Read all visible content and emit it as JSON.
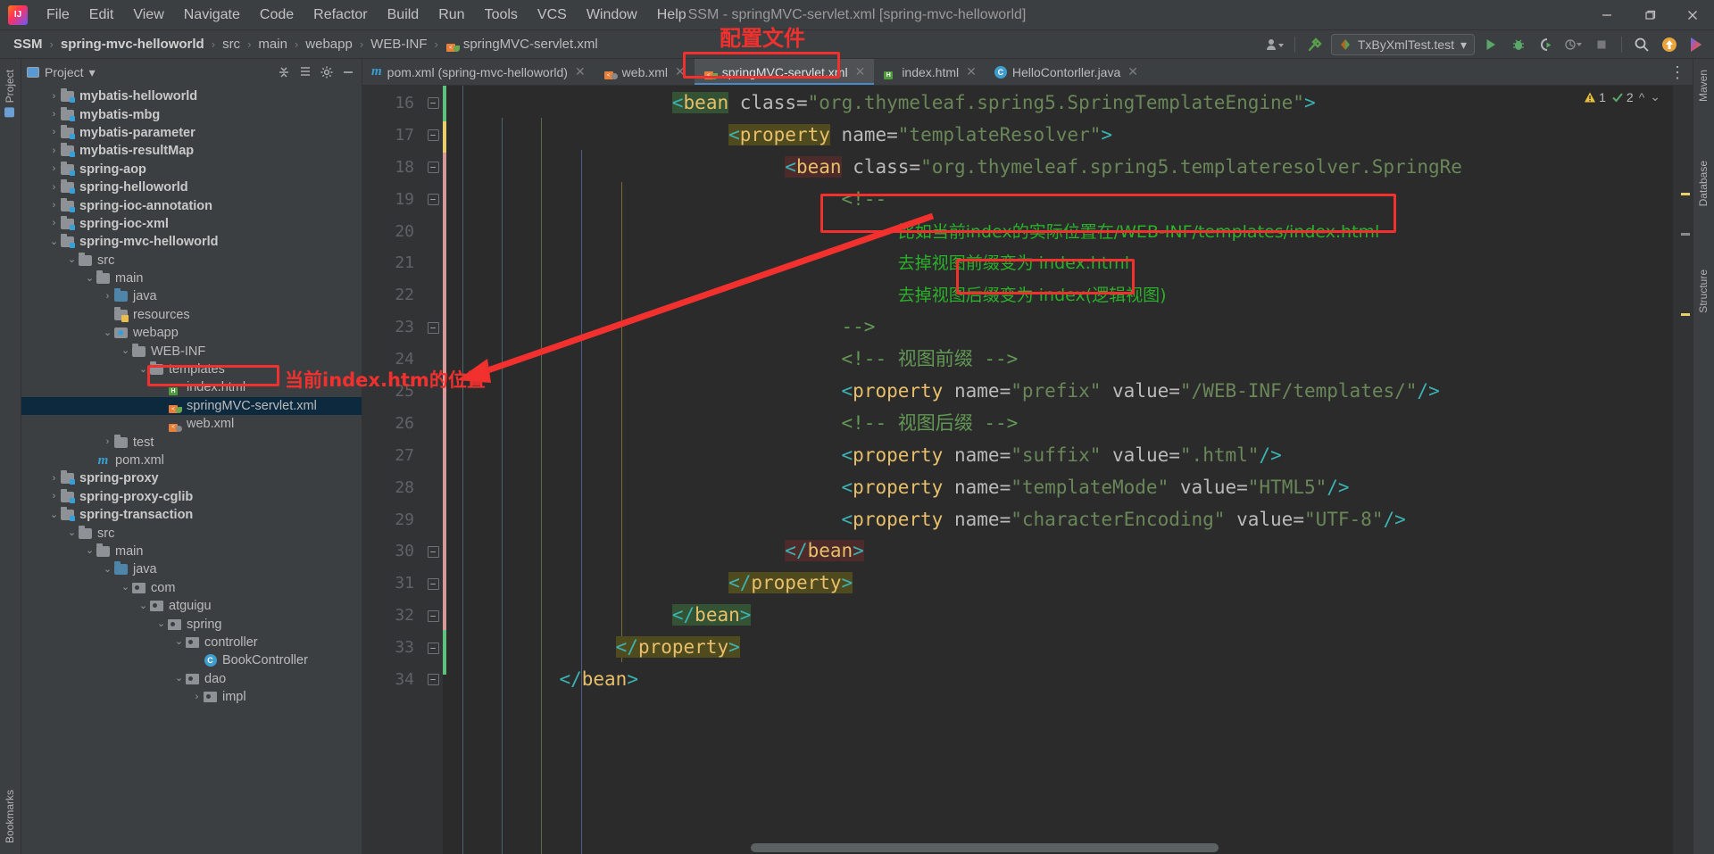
{
  "window": {
    "title": "SSM - springMVC-servlet.xml [spring-mvc-helloworld]",
    "minimize": "—",
    "maximize": "❐",
    "close": "✕"
  },
  "menu": {
    "items": [
      "File",
      "Edit",
      "View",
      "Navigate",
      "Code",
      "Refactor",
      "Build",
      "Run",
      "Tools",
      "VCS",
      "Window",
      "Help"
    ]
  },
  "breadcrumb": {
    "items": [
      "SSM",
      "spring-mvc-helloworld",
      "src",
      "main",
      "webapp",
      "WEB-INF",
      "springMVC-servlet.xml"
    ],
    "separator": "›"
  },
  "toolbar": {
    "run_config": "TxByXmlTest.test",
    "dropdown_caret": "▾",
    "run_label": "run-icon",
    "debug_label": "debug-icon",
    "coverage_label": "run-with-coverage-icon",
    "profile_label": "profiler-icon",
    "stop_label": "stop-icon",
    "search_label": "search-everywhere-icon",
    "update_label": "update-project-icon",
    "settings_label": "ide-assistant-icon"
  },
  "project_panel": {
    "title": "Project",
    "title_caret": "▾",
    "actions": [
      "expand-all-icon",
      "collapse-all-icon",
      "settings-icon",
      "hide-icon"
    ],
    "tree": [
      {
        "depth": 1,
        "label": "mybatis-helloworld",
        "arrow": "›",
        "icon": "module",
        "bold": true
      },
      {
        "depth": 1,
        "label": "mybatis-mbg",
        "arrow": "›",
        "icon": "module",
        "bold": true
      },
      {
        "depth": 1,
        "label": "mybatis-parameter",
        "arrow": "›",
        "icon": "module",
        "bold": true
      },
      {
        "depth": 1,
        "label": "mybatis-resultMap",
        "arrow": "›",
        "icon": "module",
        "bold": true
      },
      {
        "depth": 1,
        "label": "spring-aop",
        "arrow": "›",
        "icon": "module",
        "bold": true
      },
      {
        "depth": 1,
        "label": "spring-helloworld",
        "arrow": "›",
        "icon": "module",
        "bold": true
      },
      {
        "depth": 1,
        "label": "spring-ioc-annotation",
        "arrow": "›",
        "icon": "module",
        "bold": true
      },
      {
        "depth": 1,
        "label": "spring-ioc-xml",
        "arrow": "›",
        "icon": "module",
        "bold": true
      },
      {
        "depth": 1,
        "label": "spring-mvc-helloworld",
        "arrow": "⌄",
        "icon": "module",
        "bold": true
      },
      {
        "depth": 2,
        "label": "src",
        "arrow": "⌄",
        "icon": "folder"
      },
      {
        "depth": 3,
        "label": "main",
        "arrow": "⌄",
        "icon": "folder"
      },
      {
        "depth": 4,
        "label": "java",
        "arrow": "›",
        "icon": "folder-blue"
      },
      {
        "depth": 4,
        "label": "resources",
        "arrow": "",
        "icon": "folder-resources"
      },
      {
        "depth": 4,
        "label": "webapp",
        "arrow": "⌄",
        "icon": "webapp"
      },
      {
        "depth": 5,
        "label": "WEB-INF",
        "arrow": "⌄",
        "icon": "folder"
      },
      {
        "depth": 6,
        "label": "templates",
        "arrow": "⌄",
        "icon": "folder"
      },
      {
        "depth": 7,
        "label": "index.html",
        "arrow": "",
        "icon": "html"
      },
      {
        "depth": 7,
        "label": "springMVC-servlet.xml",
        "arrow": "",
        "icon": "xml-spring",
        "selected": true
      },
      {
        "depth": 7,
        "label": "web.xml",
        "arrow": "",
        "icon": "xml-web"
      },
      {
        "depth": 4,
        "label": "test",
        "arrow": "›",
        "icon": "folder"
      },
      {
        "depth": 3,
        "label": "pom.xml",
        "arrow": "",
        "icon": "maven"
      },
      {
        "depth": 1,
        "label": "spring-proxy",
        "arrow": "›",
        "icon": "module",
        "bold": true
      },
      {
        "depth": 1,
        "label": "spring-proxy-cglib",
        "arrow": "›",
        "icon": "module",
        "bold": true
      },
      {
        "depth": 1,
        "label": "spring-transaction",
        "arrow": "⌄",
        "icon": "module",
        "bold": true
      },
      {
        "depth": 2,
        "label": "src",
        "arrow": "⌄",
        "icon": "folder"
      },
      {
        "depth": 3,
        "label": "main",
        "arrow": "⌄",
        "icon": "folder"
      },
      {
        "depth": 4,
        "label": "java",
        "arrow": "⌄",
        "icon": "folder-blue"
      },
      {
        "depth": 5,
        "label": "com",
        "arrow": "⌄",
        "icon": "package"
      },
      {
        "depth": 6,
        "label": "atguigu",
        "arrow": "⌄",
        "icon": "package"
      },
      {
        "depth": 7,
        "label": "spring",
        "arrow": "⌄",
        "icon": "package"
      },
      {
        "depth": 8,
        "label": "controller",
        "arrow": "⌄",
        "icon": "package"
      },
      {
        "depth": 9,
        "label": "BookController",
        "arrow": "",
        "icon": "class"
      },
      {
        "depth": 8,
        "label": "dao",
        "arrow": "⌄",
        "icon": "package"
      },
      {
        "depth": 9,
        "label": "impl",
        "arrow": "›",
        "icon": "package"
      }
    ]
  },
  "editor_tabs": [
    {
      "label": "pom.xml (spring-mvc-helloworld)",
      "icon": "maven",
      "active": false
    },
    {
      "label": "web.xml",
      "icon": "xml-web",
      "active": false
    },
    {
      "label": "springMVC-servlet.xml",
      "icon": "xml-spring",
      "active": true
    },
    {
      "label": "index.html",
      "icon": "html",
      "active": false
    },
    {
      "label": "HelloContorller.java",
      "icon": "class",
      "active": false
    }
  ],
  "editor": {
    "first_line": 16,
    "line_numbers": [
      16,
      17,
      18,
      19,
      20,
      21,
      22,
      23,
      24,
      25,
      26,
      27,
      28,
      29,
      30,
      31,
      32,
      33,
      34
    ],
    "warnings": {
      "warning_count": "1",
      "weak_warning_count": "2",
      "warning_icon": "⚠",
      "weakwarn_icon": "✓"
    },
    "lines": [
      {
        "n": 16,
        "html": "<span class=\"hl-green\"><span class=\"brack\">&lt;</span><span class=\"tagname\">bean</span></span> <span class=\"attr\">class</span><span class=\"eq\">=</span><span class=\"val\">\"org.thymeleaf.spring5.SpringTemplateEngine\"</span><span class=\"brack\">&gt;</span>",
        "indent": 0
      },
      {
        "n": 17,
        "html": "<span class=\"hl-olive\"><span class=\"brack\">&lt;</span><span class=\"tagname\">property</span></span> <span class=\"attr\">name</span><span class=\"eq\">=</span><span class=\"val\">\"templateResolver\"</span><span class=\"brack\">&gt;</span>",
        "indent": 1
      },
      {
        "n": 18,
        "html": "<span class=\"hl-maroon\"><span class=\"brack\">&lt;</span><span class=\"tagname\">bean</span></span> <span class=\"attr\">class</span><span class=\"eq\">=</span><span class=\"val\">\"org.thymeleaf.spring5.templateresolver.SpringRe</span>",
        "indent": 2
      },
      {
        "n": 19,
        "html": "<span class=\"cmt\">&lt;!--</span>",
        "indent": 3
      },
      {
        "n": 20,
        "html": "<span class=\"cn\">比如当前index的实际位置在/WEB-INF/templates/index.html</span>",
        "indent": 4
      },
      {
        "n": 21,
        "html": "<span class=\"cn\">去掉视图前缀变为 index.html</span>",
        "indent": 4
      },
      {
        "n": 22,
        "html": "<span class=\"cn\">去掉视图后缀变为 index(逻辑视图)</span>",
        "indent": 4
      },
      {
        "n": 23,
        "html": "<span class=\"cmt\">--&gt;</span>",
        "indent": 3
      },
      {
        "n": 24,
        "html": "<span class=\"cmt\">&lt;!-- 视图前缀 --&gt;</span>",
        "indent": 3
      },
      {
        "n": 25,
        "html": "<span class=\"brack\">&lt;</span><span class=\"tagname\">property</span> <span class=\"attr\">name</span><span class=\"eq\">=</span><span class=\"val\">\"prefix\"</span> <span class=\"attr\">value</span><span class=\"eq\">=</span><span class=\"val\">\"/WEB-INF/templates/\"</span><span class=\"brack\">/&gt;</span>",
        "indent": 3
      },
      {
        "n": 26,
        "html": "<span class=\"cmt\">&lt;!-- 视图后缀 --&gt;</span>",
        "indent": 3
      },
      {
        "n": 27,
        "html": "<span class=\"brack\">&lt;</span><span class=\"tagname\">property</span> <span class=\"attr\">name</span><span class=\"eq\">=</span><span class=\"val\">\"suffix\"</span> <span class=\"attr\">value</span><span class=\"eq\">=</span><span class=\"val\">\".html\"</span><span class=\"brack\">/&gt;</span>",
        "indent": 3
      },
      {
        "n": 28,
        "html": "<span class=\"brack\">&lt;</span><span class=\"tagname\">property</span> <span class=\"attr\">name</span><span class=\"eq\">=</span><span class=\"val\">\"templateMode\"</span> <span class=\"attr\">value</span><span class=\"eq\">=</span><span class=\"val\">\"HTML5\"</span><span class=\"brack\">/&gt;</span>",
        "indent": 3
      },
      {
        "n": 29,
        "html": "<span class=\"brack\">&lt;</span><span class=\"tagname\">property</span> <span class=\"attr\">name</span><span class=\"eq\">=</span><span class=\"val\">\"characterEncoding\"</span> <span class=\"attr\">value</span><span class=\"eq\">=</span><span class=\"val\">\"UTF-8\"</span><span class=\"brack\">/&gt;</span>",
        "indent": 3
      },
      {
        "n": 30,
        "html": "<span class=\"hl-maroon\"><span class=\"brack\">&lt;/</span><span class=\"tagname\">bean</span><span class=\"brack\">&gt;</span></span>",
        "indent": 2
      },
      {
        "n": 31,
        "html": "<span class=\"hl-olive\"><span class=\"brack\">&lt;/</span><span class=\"tagname\">property</span><span class=\"brack\">&gt;</span></span>",
        "indent": 1
      },
      {
        "n": 32,
        "html": "<span class=\"hl-green\"><span class=\"brack\">&lt;/</span><span class=\"tagname\">bean</span><span class=\"brack\">&gt;</span></span>",
        "indent": 0
      },
      {
        "n": 33,
        "html": "<span class=\"hl-olive\"><span class=\"brack\">&lt;/</span><span class=\"tagname\">property</span><span class=\"brack\">&gt;</span></span>",
        "indent": -1
      },
      {
        "n": 34,
        "html": "<span class=\"brack\">&lt;/</span><span class=\"tagname\">bean</span><span class=\"brack\">&gt;</span>",
        "indent": -2
      }
    ]
  },
  "annotations": {
    "config_file_label": "配置文件",
    "current_index_label": "当前index.htm的位置",
    "boxes": [
      "tab-springmvc-servlet-xml",
      "tree-index-html",
      "comment-line-20",
      "logical-view-text"
    ]
  },
  "side_tools": {
    "left": [
      "Project",
      "Bookmarks"
    ],
    "right": [
      "Maven",
      "Database",
      "Structure"
    ]
  },
  "colors": {
    "accent_red": "#f2312f",
    "editor_bg": "#2b2b2b",
    "panel_bg": "#3c3f41",
    "selection": "#0d293e",
    "comment_green": "#629755",
    "tag_yellow": "#e8bf6a",
    "string_green": "#6a8759"
  }
}
